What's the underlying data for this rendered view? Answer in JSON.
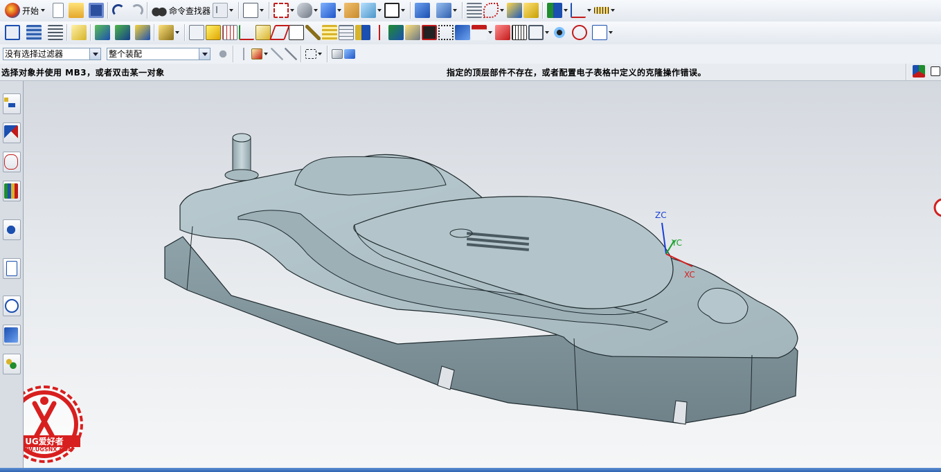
{
  "toolbar1": {
    "start_label": "开始",
    "command_finder_label": "命令查找器"
  },
  "selection_bar": {
    "filter_value": "没有选择过滤器",
    "scope_value": "整个装配"
  },
  "status_bar": {
    "prompt": "选择对象并使用 MB3，或者双击某一对象",
    "message": "指定的顶层部件不存在，或者配置电子表格中定义的克隆操作错误。"
  },
  "csys": {
    "zc": "ZC",
    "yc": "YC",
    "xc": "XC"
  },
  "watermark": {
    "brand": "UG爱好者",
    "url": "WWW.UGSNX.COM"
  },
  "colors": {
    "model_fill": "#a9bcc2",
    "model_shadow": "#7f9299",
    "model_edge": "#1f2a2e",
    "zc_axis": "#1a3fd6",
    "yc_axis": "#18a02a",
    "xc_axis": "#d41f1f",
    "watermark_red": "#d81f1f"
  }
}
